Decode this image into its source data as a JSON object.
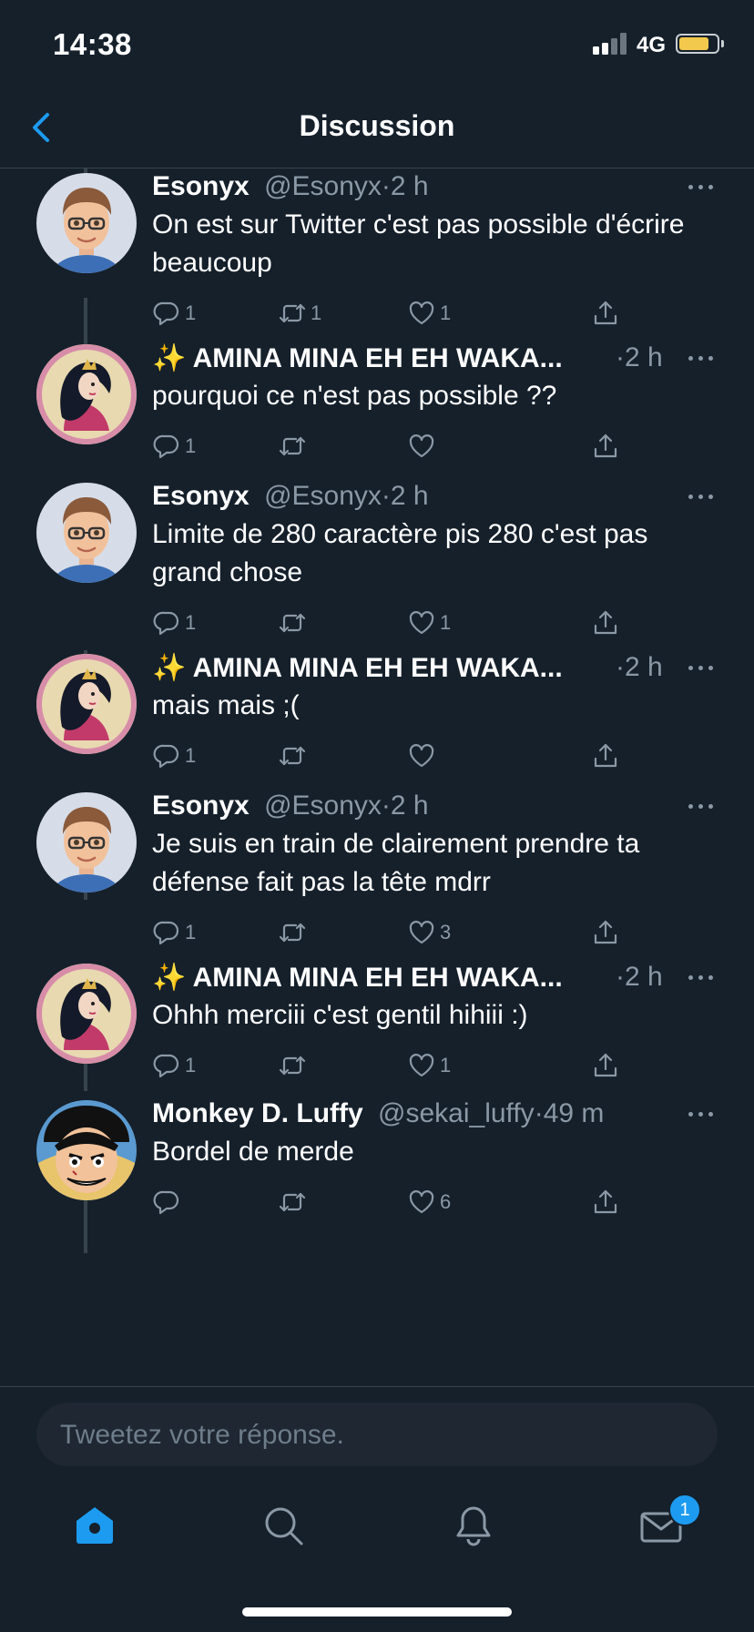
{
  "status_bar": {
    "time": "14:38",
    "network": "4G"
  },
  "header": {
    "title": "Discussion"
  },
  "tweets": [
    {
      "name": "Esonyx",
      "handle": "@Esonyx",
      "sep": "·",
      "ago": "2 h",
      "text": "On est sur Twitter c'est pas possible d'écrire beaucoup",
      "replies": "1",
      "retweets": "1",
      "likes": "1",
      "avatar": "memoji-boy"
    },
    {
      "name": "✨ AMINA MINA EH EH WAKA...",
      "handle": "",
      "sep": "·",
      "ago": "2 h",
      "text": "pourquoi ce n'est pas possible ??",
      "replies": "1",
      "retweets": "",
      "likes": "",
      "avatar": "princess"
    },
    {
      "name": "Esonyx",
      "handle": "@Esonyx",
      "sep": "·",
      "ago": "2 h",
      "text": "Limite de 280 caractère pis 280 c'est pas grand chose",
      "replies": "1",
      "retweets": "",
      "likes": "1",
      "avatar": "memoji-boy"
    },
    {
      "name": "✨ AMINA MINA EH EH WAKA...",
      "handle": "",
      "sep": "·",
      "ago": "2 h",
      "text": "mais mais ;(",
      "replies": "1",
      "retweets": "",
      "likes": "",
      "avatar": "princess"
    },
    {
      "name": "Esonyx",
      "handle": "@Esonyx",
      "sep": "·",
      "ago": "2 h",
      "text": "Je suis en train de clairement prendre ta défense fait pas la tête mdrr",
      "replies": "1",
      "retweets": "",
      "likes": "3",
      "avatar": "memoji-boy"
    },
    {
      "name": "✨ AMINA MINA EH EH WAKA...",
      "handle": "",
      "sep": "·",
      "ago": "2 h",
      "text": "Ohhh merciii c'est gentil hihiii :)",
      "replies": "1",
      "retweets": "",
      "likes": "1",
      "avatar": "princess"
    },
    {
      "name": "Monkey D. Luffy",
      "handle": "@sekai_luffy",
      "sep": "·",
      "ago": "49 m",
      "text": "Bordel de merde",
      "replies": "",
      "retweets": "",
      "likes": "6",
      "avatar": "anime-pirate"
    }
  ],
  "compose": {
    "placeholder": "Tweetez votre réponse."
  },
  "tabbar": {
    "items": [
      {
        "icon": "home-icon",
        "active": true
      },
      {
        "icon": "search-icon",
        "active": false
      },
      {
        "icon": "bell-icon",
        "active": false
      },
      {
        "icon": "mail-icon",
        "active": false
      }
    ],
    "messages_badge": "1"
  },
  "colors": {
    "background": "#15202b",
    "accent": "#1d9bf0",
    "muted": "#8b98a5",
    "divider": "#38444d"
  }
}
